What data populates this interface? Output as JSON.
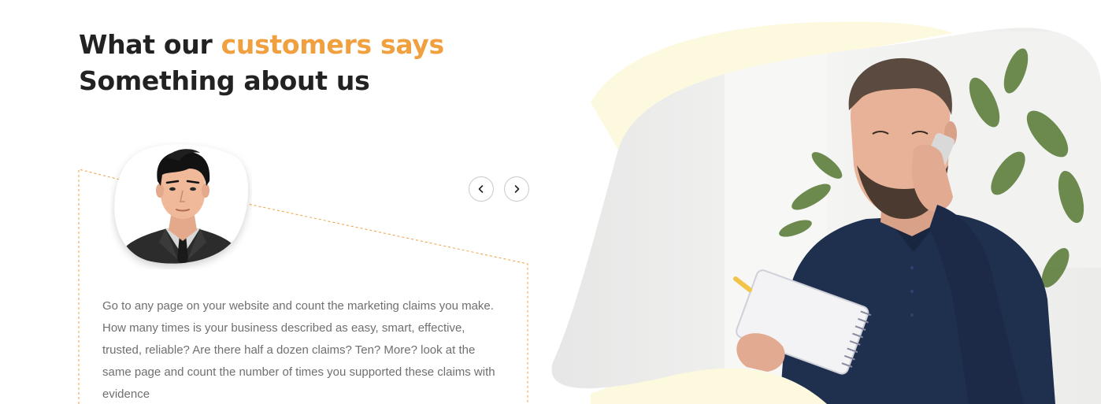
{
  "section": {
    "heading_prefix": "What our ",
    "heading_accent": "customers says",
    "heading_line2": "Something about us"
  },
  "testimonial": {
    "text": "Go to any page on your website and count the marketing claims you make. How many times is your business described as easy, smart, effective, trusted, reliable? Are there half a dozen claims? Ten? More? look at the same page and count the number of times you supported these claims with evidence"
  },
  "slider": {
    "prev_icon": "chevron-left-icon",
    "next_icon": "chevron-right-icon"
  },
  "colors": {
    "accent": "#f1a03f",
    "heading": "#222222",
    "body_text": "#6f6f6f",
    "blob_yellow": "#fdf9df",
    "dashed_border": "#f1a03f"
  }
}
